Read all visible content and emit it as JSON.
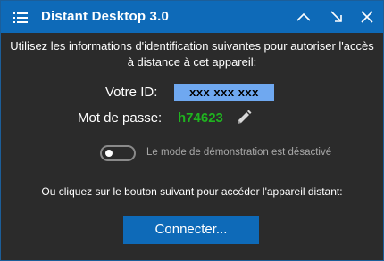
{
  "window": {
    "title": "Distant Desktop 3.0"
  },
  "info": {
    "line1": "Utilisez les informations d'identification suivantes pour autoriser l'accès",
    "line2": "à distance à cet appareil:"
  },
  "credentials": {
    "id_label": "Votre ID:",
    "id_value": "xxx xxx xxx",
    "password_label": "Mot de passe:",
    "password_value": "h74623"
  },
  "demo_mode": {
    "enabled": false,
    "label": "Le mode de démonstration est désactivé"
  },
  "connect": {
    "prompt": "Ou cliquez sur le bouton suivant pour accéder l'appareil distant:",
    "button_label": "Connecter..."
  },
  "colors": {
    "titlebar": "#0e6ab8",
    "background": "#2b2b2b",
    "id_highlight": "#6fa8f0",
    "password": "#1fb31f"
  },
  "icons": {
    "menu": "menu-icon",
    "up": "chevron-up-icon",
    "shrink": "shrink-arrow-icon",
    "close": "close-icon",
    "edit": "pencil-icon"
  }
}
